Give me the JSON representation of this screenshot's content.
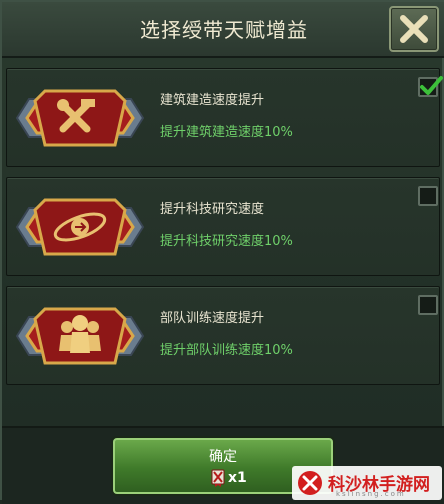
{
  "dialog": {
    "title": "选择绶带天赋增益",
    "close_icon": "close-x-icon"
  },
  "options": [
    {
      "title": "建筑建造速度提升",
      "description": "提升建筑建造速度10%",
      "checked": true,
      "icon": "wrench-hammer-emblem-icon"
    },
    {
      "title": "提升科技研究速度",
      "description": "提升科技研究速度10%",
      "checked": false,
      "icon": "science-orbit-emblem-icon"
    },
    {
      "title": "部队训练速度提升",
      "description": "提升部队训练速度10%",
      "checked": false,
      "icon": "troops-emblem-icon"
    }
  ],
  "footer": {
    "confirm_label": "确定",
    "cost_icon": "ribbon-medal-icon",
    "cost_count": "x1"
  },
  "watermark": {
    "text": "科沙林手游网",
    "sub": "kslinsng.com"
  },
  "colors": {
    "accent_green": "#6fd06a",
    "check_green": "#3cc03a",
    "badge_red": "#a51d1d",
    "badge_gold": "#d8a84a"
  }
}
